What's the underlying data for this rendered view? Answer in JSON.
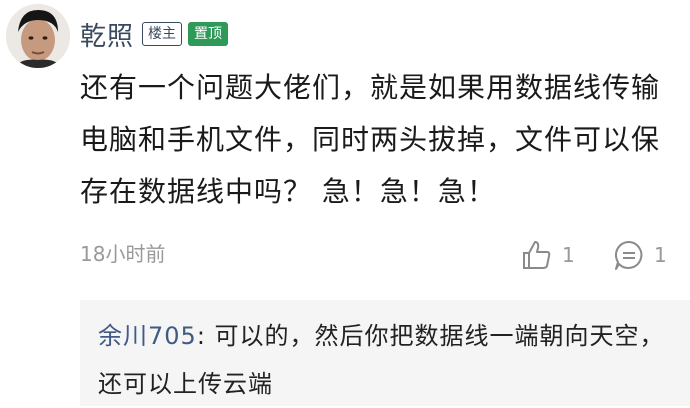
{
  "comment": {
    "username": "乾照",
    "badge_owner": "楼主",
    "badge_pinned": "置顶",
    "text": "还有一个问题大佬们，就是如果用数据线传输电脑和手机文件，同时两头拔掉，文件可以保存在数据线中吗？ 急！急！急！",
    "time": "18小时前",
    "like_count": "1",
    "reply_count": "1",
    "icons": {
      "like": "thumbs-up-icon",
      "reply": "comment-bubble-icon"
    }
  },
  "reply": {
    "author": "余川705",
    "separator": ": ",
    "text": "可以的，然后你把数据线一端朝向天空，还可以上传云端"
  },
  "colors": {
    "username": "#3a4a5e",
    "pinned_badge_bg": "#2e9a58",
    "reply_author": "#3f5a84",
    "reply_bg": "#f5f5f5",
    "muted": "#999999"
  }
}
